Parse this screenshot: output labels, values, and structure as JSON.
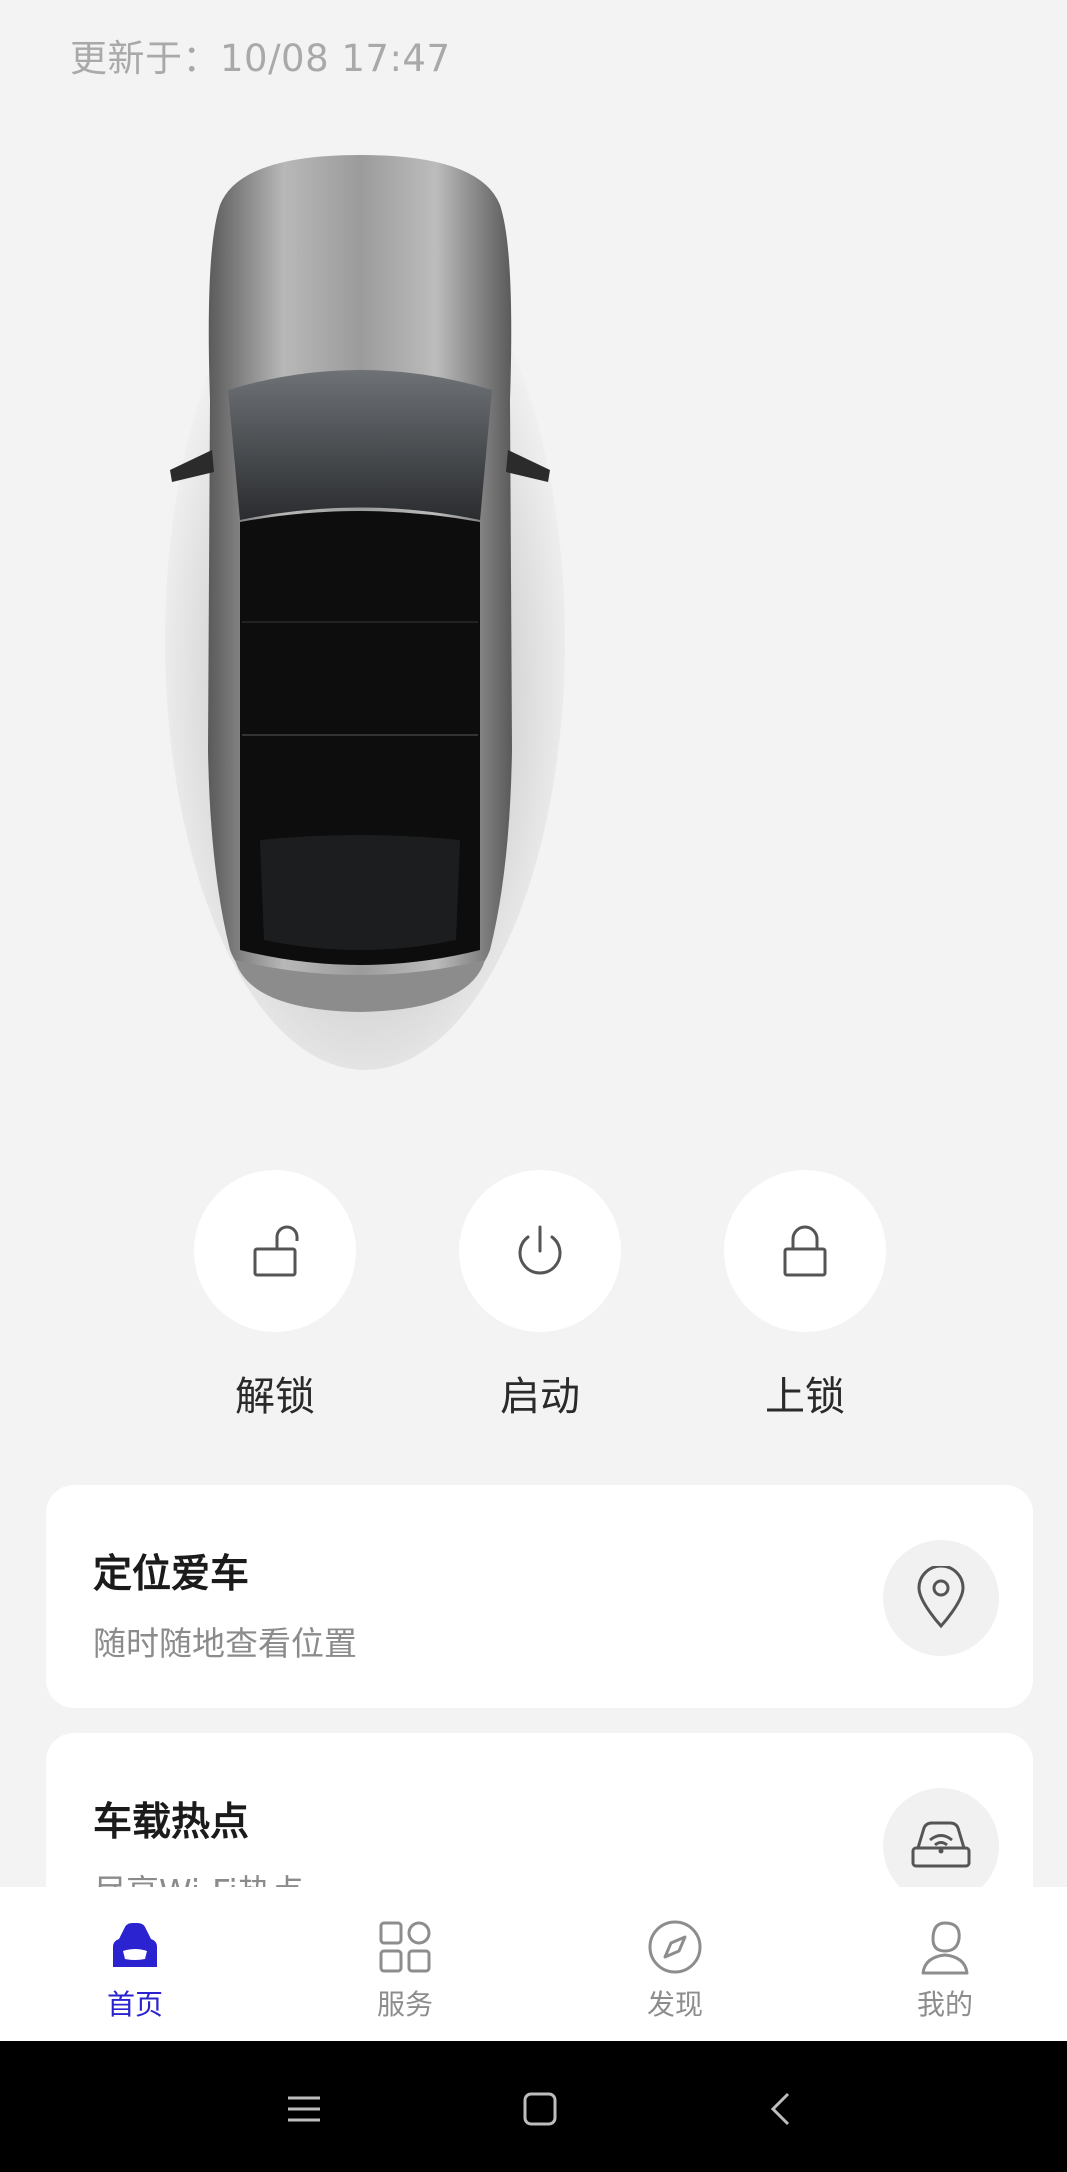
{
  "status": {
    "updated_prefix": "更新于：",
    "updated_time": "10/08 17:47"
  },
  "actions": [
    {
      "label": "解锁",
      "icon": "unlock-icon"
    },
    {
      "label": "启动",
      "icon": "power-icon"
    },
    {
      "label": "上锁",
      "icon": "lock-icon"
    }
  ],
  "cards": [
    {
      "title": "定位爱车",
      "subtitle": "随时随地查看位置",
      "icon": "location-pin-icon"
    },
    {
      "title": "车载热点",
      "subtitle": "尽享Wi-Fi热点",
      "icon": "car-wifi-icon"
    }
  ],
  "tabs": [
    {
      "label": "首页",
      "icon": "car-home-icon",
      "active": true
    },
    {
      "label": "服务",
      "icon": "grid-icon",
      "active": false
    },
    {
      "label": "发现",
      "icon": "compass-icon",
      "active": false
    },
    {
      "label": "我的",
      "icon": "profile-icon",
      "active": false
    }
  ],
  "colors": {
    "accent": "#2a23cf",
    "background": "#f3f3f3",
    "card": "#ffffff"
  },
  "system_nav": [
    "menu-icon",
    "home-square-icon",
    "back-icon"
  ]
}
